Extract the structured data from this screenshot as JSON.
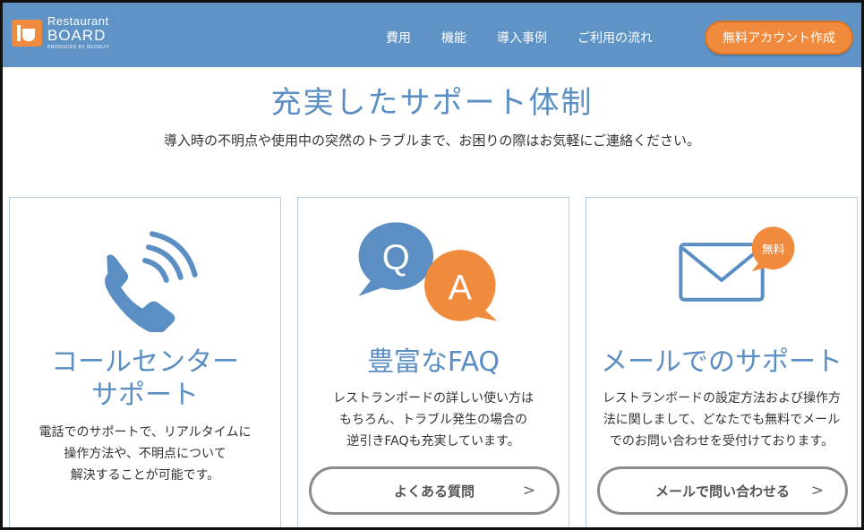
{
  "header": {
    "logo": {
      "line1": "Restaurant",
      "line2": "BOARD",
      "line3": "PRODUCED BY RECRUIT"
    },
    "nav": [
      "費用",
      "機能",
      "導入事例",
      "ご利用の流れ"
    ],
    "cta_label": "無料アカウント作成"
  },
  "hero": {
    "title": "充実したサポート体制",
    "subtitle": "導入時の不明点や使用中の突然のトラブルまで、お困りの際はお気軽にご連絡ください。"
  },
  "cards": [
    {
      "title_line1": "コールセンター",
      "title_line2": "サポート",
      "desc_lines": [
        "電話でのサポートで、リアルタイムに",
        "操作方法や、不明点について",
        "解決することが可能です。"
      ],
      "icon": "phone-icon"
    },
    {
      "title_line1": "豊富なFAQ",
      "desc_lines": [
        "レストランボードの詳しい使い方は",
        "もちろん、トラブル発生の場合の",
        "逆引きFAQも充実しています。"
      ],
      "icon": "qa-bubbles-icon",
      "bubble_q": "Q",
      "bubble_a": "A",
      "button_label": "よくある質問",
      "button_chevron": ">"
    },
    {
      "title_line1": "メールでのサポート",
      "desc_lines": [
        "レストランボードの設定方法および操作方",
        "法に関しまして、どなたでも無料でメール",
        "でのお問い合わせを受付けております。"
      ],
      "icon": "mail-icon",
      "badge": "無料",
      "button_label": "メールで問い合わせる",
      "button_chevron": ">"
    }
  ],
  "colors": {
    "header_bg": "#5f93c6",
    "accent_orange": "#f08a3c",
    "title_blue": "#5b8fc3",
    "card_border": "#b7cfe6"
  }
}
